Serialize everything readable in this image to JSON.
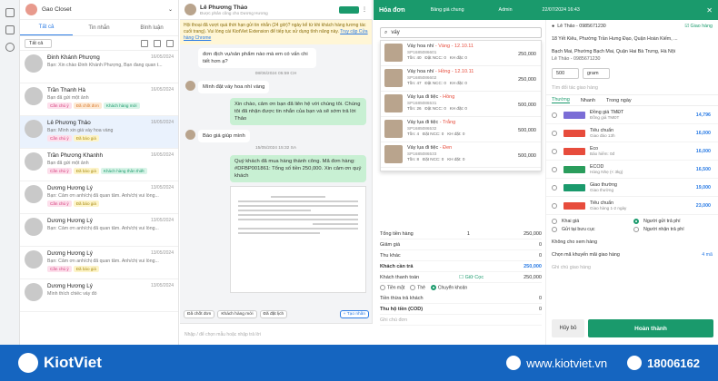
{
  "shop": {
    "name": "Gao Closet"
  },
  "chat_tabs": [
    {
      "label": "Tất cả"
    },
    {
      "label": "Tin nhắn"
    },
    {
      "label": "Bình luận"
    }
  ],
  "filter": {
    "label": "Tất cả"
  },
  "conversations": [
    {
      "name": "Đinh Khánh Phượng",
      "preview": "Bạn: Xin chào Đinh Khánh Phượng, Bạn đang quan t...",
      "date": "16/05/2024",
      "tags": []
    },
    {
      "name": "Trần Thanh Hà",
      "preview": "Bạn đã gửi một ảnh",
      "date": "16/05/2024",
      "tags": [
        "Cần chú ý",
        "Đã chốt đơn",
        "Khách hàng mới"
      ]
    },
    {
      "name": "Lê Phương Thảo",
      "preview": "Bạn: Mình xin giá váy hoa vàng",
      "date": "16/05/2024",
      "tags": [
        "Cần chú ý",
        "Đã báo giá"
      ]
    },
    {
      "name": "Trần Phương Khanhh",
      "preview": "Bạn đã gửi một ảnh",
      "date": "16/05/2024",
      "tags": [
        "Cần chú ý",
        "Đã báo giá",
        "Khách hàng thân thiết"
      ]
    },
    {
      "name": "Dương Hương Lý",
      "preview": "Bạn: Cảm ơn anh/chị đã quan tâm. Anh/chị vui lòng...",
      "date": "13/05/2024",
      "tags": [
        "Cần chú ý",
        "Đã báo giá"
      ]
    },
    {
      "name": "Dương Hương Lý",
      "preview": "Bạn: Cảm ơn anh/chị đã quan tâm. Anh/chị vui lòng...",
      "date": "13/05/2024",
      "tags": []
    },
    {
      "name": "Dương Hương Lý",
      "preview": "Bạn: Cảm ơn anh/chị đã quan tâm. Anh/chị vui lòng...",
      "date": "13/05/2024",
      "tags": [
        "Cần chú ý",
        "Đã báo giá"
      ]
    },
    {
      "name": "Dương Hương Lý",
      "preview": "Mình thích chiếc váy đó",
      "date": "13/05/2024",
      "tags": []
    }
  ],
  "chat": {
    "name": "Lê Phương Thảo",
    "subtitle": "Được phân công cho Dương Hương",
    "warning": "Hội thoại đã vượt quá thời hạn gửi tin nhắn (24 giờ)? ngày kể từ khi khách hàng tương tác cuối trang). Vui lòng cài KiotViet Extension để tiếp tục sử dụng tính năng này.",
    "warning_link": "Truy cập Cửa hàng Chrome",
    "top_bubble": "đơn địch vụ/sản phẩm nào mà em có vấn chi tiết hơn ạ?",
    "ts1": "08/06/2024 05:59 CH",
    "m1": "Mình đặt váy hoa nhí vàng",
    "out1": "Xin chào, cảm ơn bạn đã liên hệ với chúng tôi. Chúng tôi đã nhận được tin nhắn của bạn và sẽ sớm trả lời Thảo",
    "m2": "Báo giá giúp mình",
    "ts2": "15/05/2024 15:32 SA",
    "out2": "Quý khách đã mua hàng thành công. Mã đơn hàng: #DFBP001861: Tổng số tiền 250,000. Xin cảm ơn quý khách",
    "quick": [
      "Đã chốt đơn",
      "Khách hàng mới",
      "Đã đặt lịch"
    ],
    "quick_add": "+ Tạo nhãn",
    "input_placeholder": "Nhập / để chọn mẫu hoặc nhập trả lời"
  },
  "order": {
    "title": "Hóa đơn",
    "price_list": "Bảng giá chung",
    "user": "Admin",
    "datetime": "22/07/2024 16:43",
    "search": "váy",
    "products": [
      {
        "name": "Váy hoa nhí",
        "variant": "- Vàng - 12.10.11",
        "sku": "SP1685086601",
        "stock": "Tồn: 40",
        "ncc": "Đặt NCC: 0",
        "kh": "KH đặt: 0",
        "price": "250,000"
      },
      {
        "name": "Váy hoa nhí",
        "variant": "- Hồng - 12.10.11",
        "sku": "SP1685086602",
        "stock": "Tồn: 47",
        "ncc": "Đặt NCC: 0",
        "kh": "KH đặt: 0",
        "price": "250,000"
      },
      {
        "name": "Váy lụa đi tiệc",
        "variant": "- Hồng",
        "sku": "SP1685086531",
        "stock": "Tồn: 26",
        "ncc": "Đặt NCC: 0",
        "kh": "KH đặt: 0",
        "price": "500,000"
      },
      {
        "name": "Váy lụa đi tiệc",
        "variant": "- Trắng",
        "sku": "SP1685086532",
        "stock": "Tồn: 4",
        "ncc": "Đặt NCC: 0",
        "kh": "KH đặt: 0",
        "price": "500,000"
      },
      {
        "name": "Váy lụa đi tiệc",
        "variant": "- Đen",
        "sku": "SP1685086533",
        "stock": "Tồn: 8",
        "ncc": "Đặt NCC: 0",
        "kh": "KH đặt: 0",
        "price": "500,000"
      }
    ],
    "summary": {
      "total_label": "Tổng tiền hàng",
      "total_count": "1",
      "total": "250,000",
      "discount_label": "Giảm giá",
      "discount": "0",
      "other_label": "Thu khác",
      "other": "0",
      "pay_label": "Khách cần trả",
      "pay": "250,000",
      "paid_label": "Khách thanh toán",
      "paid": "250,000",
      "cod_label": "Giữ Cọc",
      "methods": [
        "Tiền mặt",
        "Thẻ",
        "Chuyển khoản"
      ],
      "change_label": "Tiền thừa trả khách",
      "change": "0",
      "codfee_label": "Thu hộ tiền (COD)",
      "codfee": "0",
      "note": "Ghi chú đơn"
    }
  },
  "shipping": {
    "cust_name": "Lê Thảo - 0985671230",
    "deliver": "Giao hàng",
    "from": "18 Yết Kiêu, Phường Trần Hưng Đạo, Quận Hoàn Kiếm, ...",
    "to": "Bạch Mai, Phường Bạch Mai, Quận Hai Bà Trưng, Hà Nội",
    "to_name": "Lê Thảo - 0985671230",
    "weight": "500",
    "unit": "gram",
    "partner_search": "Tìm đối tác giao hàng",
    "tabs": [
      "Thường",
      "Nhanh",
      "Trong ngày"
    ],
    "carriers": [
      {
        "name": "Đồng giá TMĐT",
        "sub": "Đồng giá TMĐT",
        "price": "14,796",
        "color": "#7b6dd6"
      },
      {
        "name": "Tiêu chuẩn",
        "sub": "Giao đáo 13h",
        "price": "16,000",
        "color": "#e74c3c"
      },
      {
        "name": "Eco",
        "sub": "Bảo hiểm: 0đ",
        "price": "16,000",
        "color": "#e74c3c"
      },
      {
        "name": "ECOD",
        "sub": "Hàng Nhẹ (< 3kg)",
        "price": "16,500",
        "color": "#2a9d5c"
      },
      {
        "name": "Giao thường",
        "sub": "Giao thường",
        "price": "19,000",
        "color": "#1a9a6c"
      },
      {
        "name": "Tiêu chuẩn",
        "sub": "Giao hàng 1-2 ngày",
        "price": "23,000",
        "color": "#e74c3c"
      }
    ],
    "opts": [
      "Khai giá",
      "Người gửi trả phí",
      "Gửi tại bưu cục",
      "Người nhận trả phí"
    ],
    "view": "Không cho xem hàng",
    "promo": "Chọn mã khuyến mãi giao hàng",
    "promo_badge": "4 mã",
    "note": "Ghi chú giao hàng",
    "cancel": "Hủy bỏ",
    "done": "Hoàn thành"
  },
  "footer": {
    "brand": "KiotViet",
    "web": "www.kiotviet.vn",
    "phone": "18006162"
  }
}
